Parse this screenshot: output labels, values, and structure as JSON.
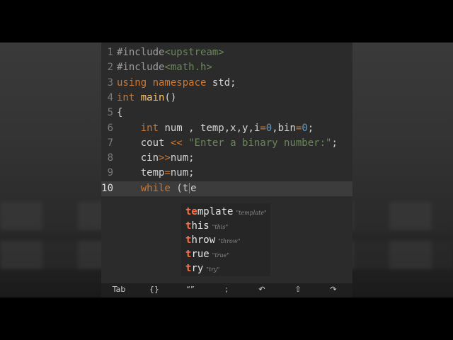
{
  "editor": {
    "lines": [
      {
        "num": "1",
        "parts": [
          {
            "t": "#include",
            "c": "inc"
          },
          {
            "t": "<upstream>",
            "c": "hdr"
          }
        ]
      },
      {
        "num": "2",
        "parts": [
          {
            "t": "#include",
            "c": "inc"
          },
          {
            "t": "<math.h>",
            "c": "hdr"
          }
        ]
      },
      {
        "num": "3",
        "parts": [
          {
            "t": "using namespace",
            "c": "kw"
          },
          {
            "t": " std;",
            "c": ""
          }
        ]
      },
      {
        "num": "4",
        "parts": [
          {
            "t": "int",
            "c": "kw"
          },
          {
            "t": " ",
            "c": ""
          },
          {
            "t": "main",
            "c": "fn"
          },
          {
            "t": "()",
            "c": ""
          }
        ]
      },
      {
        "num": "5",
        "parts": [
          {
            "t": "{",
            "c": ""
          }
        ]
      },
      {
        "num": "6",
        "parts": [
          {
            "t": "    ",
            "c": ""
          },
          {
            "t": "int",
            "c": "kw"
          },
          {
            "t": " num , temp,x,y,i",
            "c": ""
          },
          {
            "t": "=",
            "c": "op"
          },
          {
            "t": "0",
            "c": "num"
          },
          {
            "t": ",bin",
            "c": ""
          },
          {
            "t": "=",
            "c": "op"
          },
          {
            "t": "0",
            "c": "num"
          },
          {
            "t": ";",
            "c": ""
          }
        ]
      },
      {
        "num": "7",
        "parts": [
          {
            "t": "    cout ",
            "c": ""
          },
          {
            "t": "<<",
            "c": "op"
          },
          {
            "t": " ",
            "c": ""
          },
          {
            "t": "\"Enter a binary number:\"",
            "c": "str"
          },
          {
            "t": ";",
            "c": ""
          }
        ]
      },
      {
        "num": "8",
        "parts": [
          {
            "t": "    cin",
            "c": ""
          },
          {
            "t": ">>",
            "c": "op"
          },
          {
            "t": "num;",
            "c": ""
          }
        ]
      },
      {
        "num": "9",
        "parts": [
          {
            "t": "    temp",
            "c": ""
          },
          {
            "t": "=",
            "c": "op"
          },
          {
            "t": "num;",
            "c": ""
          }
        ]
      },
      {
        "num": "10",
        "parts": [
          {
            "t": "    ",
            "c": ""
          },
          {
            "t": "while",
            "c": "kw"
          },
          {
            "t": " (t",
            "c": ""
          },
          {
            "t": "|",
            "c": "cursor"
          },
          {
            "t": "e",
            "c": ""
          }
        ],
        "current": true
      }
    ]
  },
  "autocomplete": {
    "items": [
      {
        "match": "te",
        "rest": "mplate",
        "hint": "\"template\""
      },
      {
        "match": "t",
        "rest": "his",
        "hint": "\"this\""
      },
      {
        "match": "t",
        "rest": "hrow",
        "hint": "\"throw\""
      },
      {
        "match": "t",
        "rest": "rue",
        "hint": "\"true\""
      },
      {
        "match": "t",
        "rest": "ry",
        "hint": "\"try\""
      }
    ]
  },
  "toolbar": {
    "tab_label": "Tab",
    "braces_label": "{}",
    "quotes_label": "“”",
    "semicolon_label": ";",
    "undo_icon": "↶",
    "shift_icon": "⇧",
    "redo_icon": "↷"
  }
}
